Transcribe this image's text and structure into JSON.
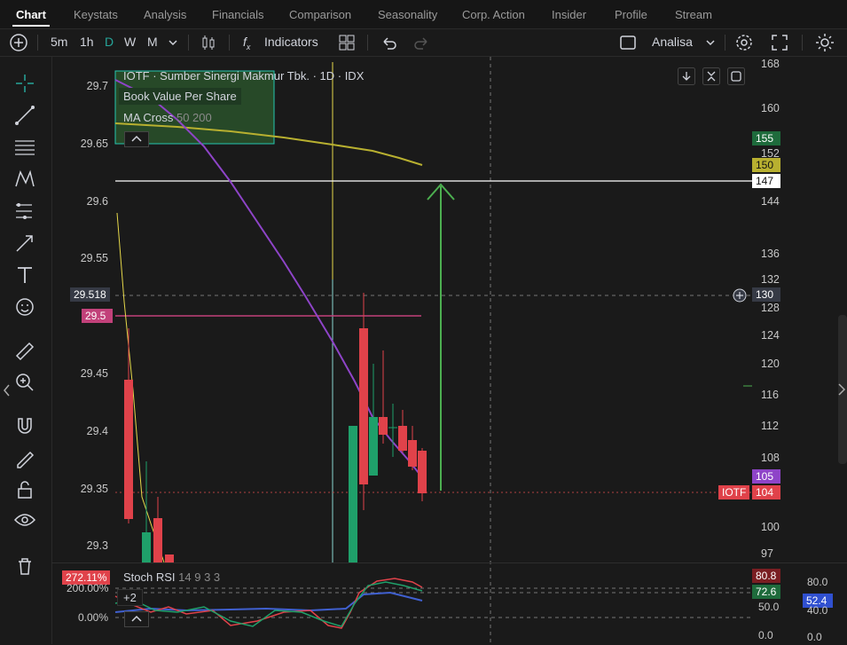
{
  "tabs": [
    {
      "label": "Chart",
      "active": true
    },
    {
      "label": "Keystats"
    },
    {
      "label": "Analysis"
    },
    {
      "label": "Financials"
    },
    {
      "label": "Comparison"
    },
    {
      "label": "Seasonality"
    },
    {
      "label": "Corp. Action"
    },
    {
      "label": "Insider"
    },
    {
      "label": "Profile"
    },
    {
      "label": "Stream"
    }
  ],
  "toolbar": {
    "intervals": [
      "5m",
      "1h",
      "D",
      "W",
      "M"
    ],
    "active_interval": "D",
    "indicators_label": "Indicators",
    "layout_label": "Analisa"
  },
  "legend": {
    "title": "IOTF · Sumber Sinergi Makmur Tbk. · 1D · IDX",
    "line1": "Book Value Per Share",
    "line2_name": "MA Cross",
    "line2_params": "50 200"
  },
  "left_axis": {
    "ticks": [
      "29.7",
      "29.65",
      "29.6",
      "29.55",
      "29.45",
      "29.4",
      "29.35",
      "29.3"
    ],
    "crosshair_value": "29.518",
    "marker_value": "29.5"
  },
  "right_axis": {
    "ticks": [
      "168",
      "160",
      "152",
      "144",
      "136",
      "132",
      "128",
      "124",
      "120",
      "116",
      "112",
      "108",
      "100",
      "97"
    ],
    "badges": {
      "green": "155",
      "ma": "150",
      "line": "147",
      "crosshair": "130",
      "purple": "105",
      "price": "104",
      "ticker": "IOTF"
    }
  },
  "stoch": {
    "name": "Stoch RSI",
    "params": "14 9 3 3",
    "left_badge": "272.11%",
    "left_ticks": [
      "200.00%",
      "0.00%"
    ],
    "more_label": "+2",
    "right_badges": {
      "red": "80.8",
      "green": "72.6",
      "blue": "52.4"
    },
    "right_ticks": [
      "80.0",
      "50.0",
      "40.0",
      "0.0",
      "0.0"
    ]
  },
  "colors": {
    "up": "#1fa06a",
    "down": "#e0424a",
    "ma": "#b8b030",
    "purple": "#8e44c8",
    "accent": "#26a69a"
  }
}
